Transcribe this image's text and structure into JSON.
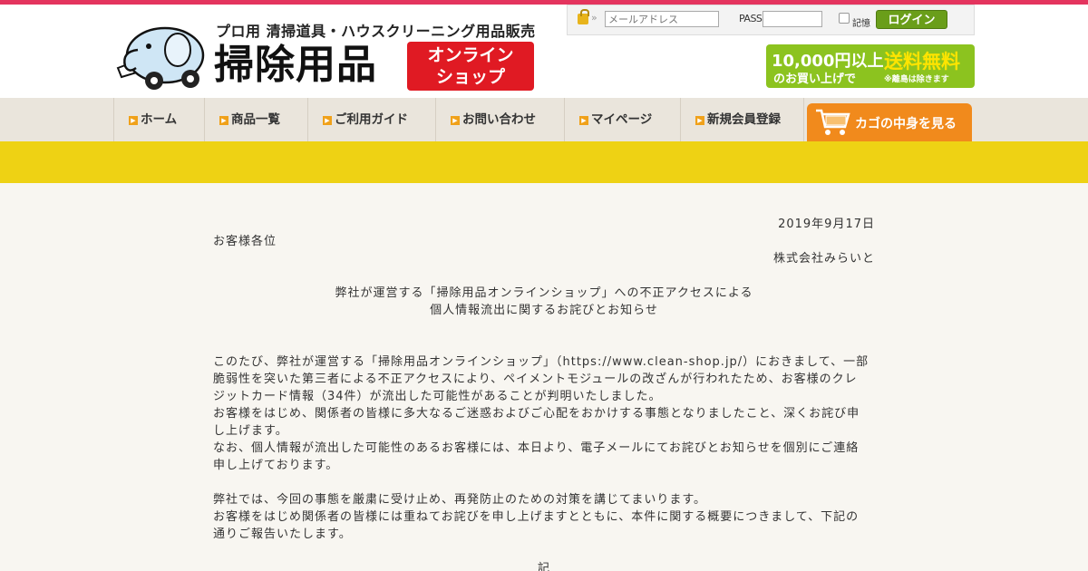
{
  "header": {
    "tagline": "プロ用 清掃道具・ハウスクリーニング用品販売",
    "brand": "掃除用品",
    "badge_line1": "オンライン",
    "badge_line2": "ショップ"
  },
  "login": {
    "email_placeholder": "メールアドレス",
    "pass_label": "PASS:",
    "remember_label": "記憶",
    "login_button": "ログイン"
  },
  "free_shipping": {
    "line1": "10,000円以上",
    "line2": "のお買い上げで",
    "big": "送料無料",
    "note": "※離島は除きます"
  },
  "nav": {
    "items": [
      {
        "label": "ホーム"
      },
      {
        "label": "商品一覧"
      },
      {
        "label": "ご利用ガイド"
      },
      {
        "label": "お問い合わせ"
      },
      {
        "label": "マイページ"
      },
      {
        "label": "新規会員登録"
      }
    ],
    "cart": "カゴの中身を見る"
  },
  "notice": {
    "date": "2019年9月17日",
    "recipient": "お客様各位",
    "company": "株式会社みらいと",
    "title_line1": "弊社が運営する「掃除用品オンラインショップ」への不正アクセスによる",
    "title_line2": "個人情報流出に関するお詫びとお知らせ",
    "p1_l1": "このたび、弊社が運営する「掃除用品オンラインショップ」（https://www.clean-shop.jp/）におきまして、一部",
    "p1_l2": "脆弱性を突いた第三者による不正アクセスにより、ペイメントモジュールの改ざんが行われたため、お客様のクレ",
    "p1_l3": "ジットカード情報（34件）が流出した可能性があることが判明いたしました。",
    "p2_l1": "お客様をはじめ、関係者の皆様に多大なるご迷惑およびご心配をおかけする事態となりましたこと、深くお詫び申",
    "p2_l2": "し上げます。",
    "p3_l1": "なお、個人情報が流出した可能性のあるお客様には、本日より、電子メールにてお詫びとお知らせを個別にご連絡",
    "p3_l2": "申し上げております。",
    "p4_l1": "弊社では、今回の事態を厳粛に受け止め、再発防止のための対策を講じてまいります。",
    "p5_l1": "お客様をはじめ関係者の皆様には重ねてお詫びを申し上げますとともに、本件に関する概要につきまして、下記の",
    "p5_l2": "通りご報告いたします。",
    "ki": "記"
  }
}
